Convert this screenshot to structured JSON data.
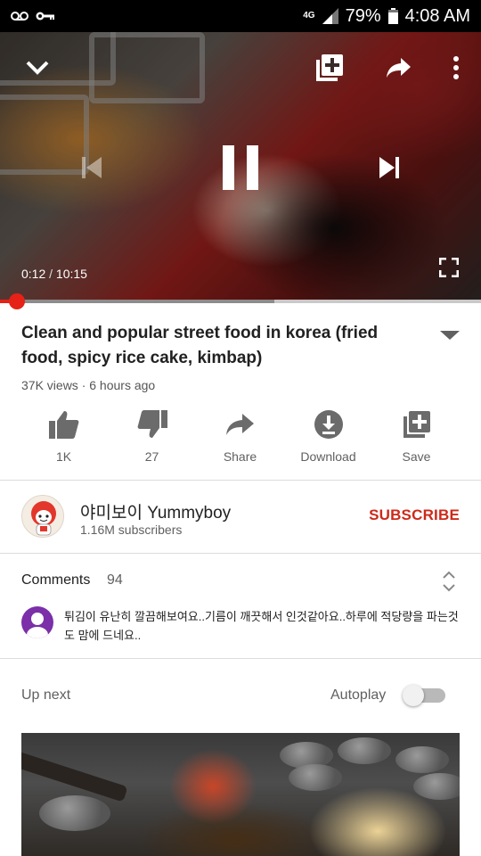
{
  "status_bar": {
    "icons_left": [
      "voicemail-icon",
      "key-icon"
    ],
    "network": "4G",
    "battery": "79%",
    "time": "4:08 AM"
  },
  "player": {
    "current_time": "0:12",
    "separator": " / ",
    "duration": "10:15",
    "progress_fraction": 0.019,
    "buffered_fraction": 0.57,
    "controls": [
      "collapse-icon",
      "add-to-playlist-icon",
      "share-icon",
      "more-icon",
      "previous-icon",
      "pause-icon",
      "next-icon",
      "fullscreen-icon"
    ]
  },
  "video": {
    "title": "Clean and popular street food in korea (fried food, spicy rice cake, kimbap)",
    "meta": "37K views · 6 hours ago"
  },
  "actions": [
    {
      "icon": "thumb-up-icon",
      "label": "1K"
    },
    {
      "icon": "thumb-down-icon",
      "label": "27"
    },
    {
      "icon": "share-icon",
      "label": "Share"
    },
    {
      "icon": "download-icon",
      "label": "Download"
    },
    {
      "icon": "save-icon",
      "label": "Save"
    }
  ],
  "channel": {
    "name": "야미보이 Yummyboy",
    "subscribers": "1.16M subscribers",
    "subscribe_label": "SUBSCRIBE"
  },
  "comments": {
    "label": "Comments",
    "count": "94",
    "top_comment": "튀김이 유난히 깔끔해보여요..기름이 깨끗해서 인것같아요..하루에 적당량을 파는것도 맘에 드네요.."
  },
  "up_next": {
    "label": "Up next",
    "autoplay_label": "Autoplay",
    "autoplay_on": false
  },
  "colors": {
    "accent_red": "#e62117",
    "subscribe_red": "#cc2a1a"
  }
}
